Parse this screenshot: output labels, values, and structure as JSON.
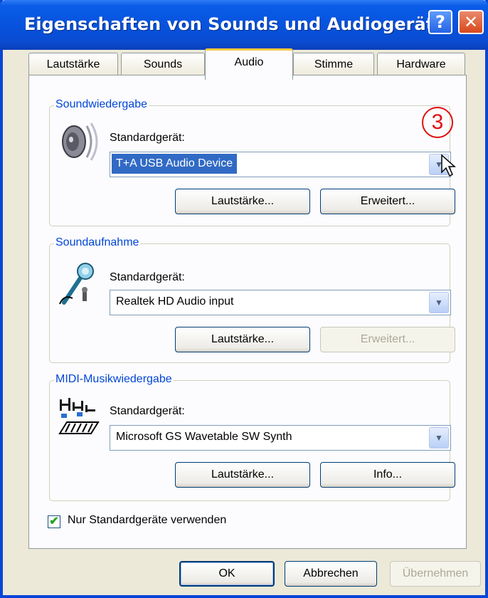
{
  "window": {
    "title": "Eigenschaften von Sounds und Audiogeräte",
    "help_label": "?",
    "close_label": "✕"
  },
  "tabs": [
    {
      "label": "Lautstärke"
    },
    {
      "label": "Sounds"
    },
    {
      "label": "Audio"
    },
    {
      "label": "Stimme"
    },
    {
      "label": "Hardware"
    }
  ],
  "active_tab": "Audio",
  "playback": {
    "legend": "Soundwiedergabe",
    "icon": "speaker-icon",
    "device_label": "Standardgerät:",
    "device_value": "T+A USB Audio Device",
    "volume_button": "Lautstärke...",
    "advanced_button": "Erweitert...",
    "marker": "3"
  },
  "recording": {
    "legend": "Soundaufnahme",
    "icon": "microphone-icon",
    "device_label": "Standardgerät:",
    "device_value": "Realtek HD Audio input",
    "volume_button": "Lautstärke...",
    "advanced_button": "Erweitert..."
  },
  "midi": {
    "legend": "MIDI-Musikwiedergabe",
    "icon": "midi-keyboard-icon",
    "device_label": "Standardgerät:",
    "device_value": "Microsoft GS Wavetable SW Synth",
    "volume_button": "Lautstärke...",
    "info_button": "Info..."
  },
  "checkbox": {
    "label": "Nur Standardgeräte verwenden",
    "checked": true
  },
  "footer": {
    "ok": "OK",
    "cancel": "Abbrechen",
    "apply": "Übernehmen"
  },
  "colors": {
    "titlebar": "#0a5ce8",
    "accent": "#0046d5",
    "selection": "#316ac5",
    "marker": "#e01010"
  }
}
